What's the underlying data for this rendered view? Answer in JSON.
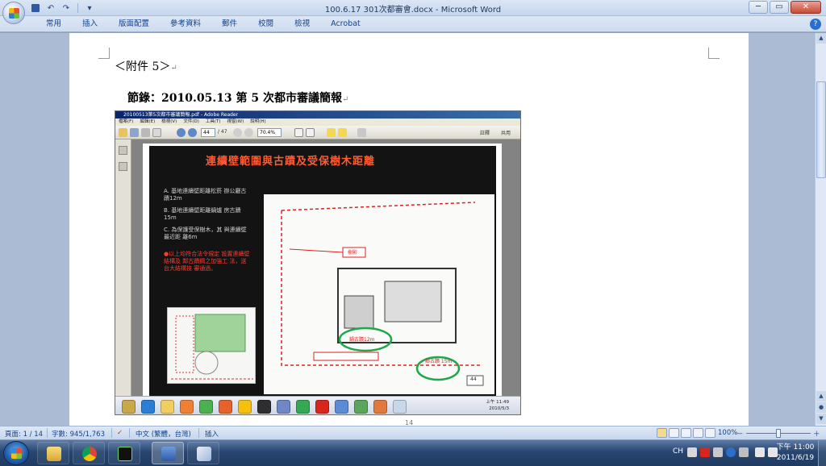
{
  "window": {
    "title": "100.6.17 301次都審會.docx - Microsoft Word",
    "minimize": "─",
    "restore": "▭",
    "close": "✕"
  },
  "qat": {
    "save_icon": "floppy-icon",
    "undo_icon": "undo-icon",
    "redo_icon": "redo-icon",
    "customize": "▾"
  },
  "ribbon": {
    "tabs": [
      "常用",
      "插入",
      "版面配置",
      "參考資料",
      "郵件",
      "校閱",
      "檢視",
      "Acrobat"
    ],
    "help": "?"
  },
  "document": {
    "heading1": "＜附件 5＞",
    "heading2": "節錄：2010.05.13 第 5 次都市審議簡報",
    "para_mark": "↵",
    "page_number": "14"
  },
  "reader": {
    "title": "20100513第5次都市審議簡報.pdf - Adobe Reader",
    "menu": [
      "檔案(F)",
      "編輯(E)",
      "檢視(V)",
      "文件(D)",
      "工具(T)",
      "視窗(W)",
      "說明(H)"
    ],
    "page_field": "44",
    "page_total": "/ 47",
    "zoom": "70.4%",
    "comment": "註釋",
    "share": "共用",
    "clock_time": "上午 11:49",
    "clock_date": "2010/5/3"
  },
  "slide": {
    "title": "連續壁範圍與古蹟及受保樹木距離",
    "items": [
      "A. 基地連續壁距離松菸 辦公廳古蹟12m",
      "B. 基地連續壁距離鍋爐 房古蹟15m",
      "C. 為保護受保樹木，其 與連續壁最近距 離6m"
    ],
    "note": "●以上均符合法令規定 設置連續壁結構及 鄰古蹟鋼之加強工 法，送台大結構技 審通過。",
    "map_labels": [
      "樹影",
      "鍋古蹟12m",
      "鄰古蹟 15m",
      "44"
    ],
    "highlight_color": "#1fa84a",
    "accent_color": "#ff3b2f"
  },
  "statusbar": {
    "page": "頁面: 1 / 14",
    "words": "字數: 945/1,763",
    "language": "中文 (繁體，台灣)",
    "mode": "插入",
    "zoom": "100%",
    "zoom_out": "－",
    "zoom_in": "＋"
  },
  "taskbar": {
    "lang": "CH",
    "time": "下午 11:00",
    "date": "2011/6/19"
  }
}
